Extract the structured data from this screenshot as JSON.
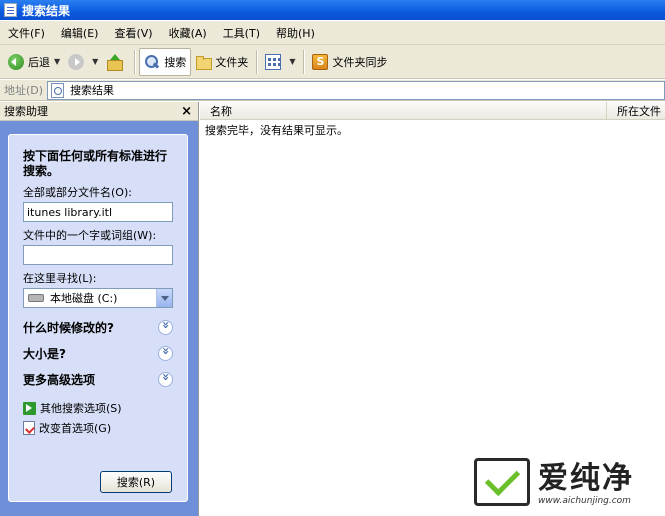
{
  "window": {
    "title": "搜索结果"
  },
  "menu": [
    "文件(F)",
    "编辑(E)",
    "查看(V)",
    "收藏(A)",
    "工具(T)",
    "帮助(H)"
  ],
  "toolbar": {
    "back": "后退",
    "search": "搜索",
    "folders": "文件夹",
    "sync": "文件夹同步"
  },
  "address": {
    "label": "地址(D)",
    "value": "搜索结果"
  },
  "pane": {
    "title": "搜索助理",
    "close": "×",
    "intro": "按下面任何或所有标准进行搜索。",
    "filename_label": "全部或部分文件名(O):",
    "filename_value": "itunes library.itl",
    "word_label": "文件中的一个字或词组(W):",
    "word_value": "",
    "lookin_label": "在这里寻找(L):",
    "lookin_value": "本地磁盘 (C:)",
    "when_label": "什么时候修改的?",
    "size_label": "大小是?",
    "advanced_label": "更多高级选项",
    "other_link": "其他搜索选项(S)",
    "prefs_link": "改变首选项(G)",
    "search_button": "搜索(R)"
  },
  "results": {
    "columns": [
      "名称",
      "所在文件"
    ],
    "message": "搜索完毕，没有结果可显示。"
  },
  "watermark": {
    "brand": "爱纯净",
    "url": "www.aichunjing.com"
  },
  "colors": {
    "title_bar": "#0a5ae0",
    "pane_bg": "#6f8fd8",
    "panel_bg": "#d6dff7",
    "chrome": "#ece9d8"
  }
}
